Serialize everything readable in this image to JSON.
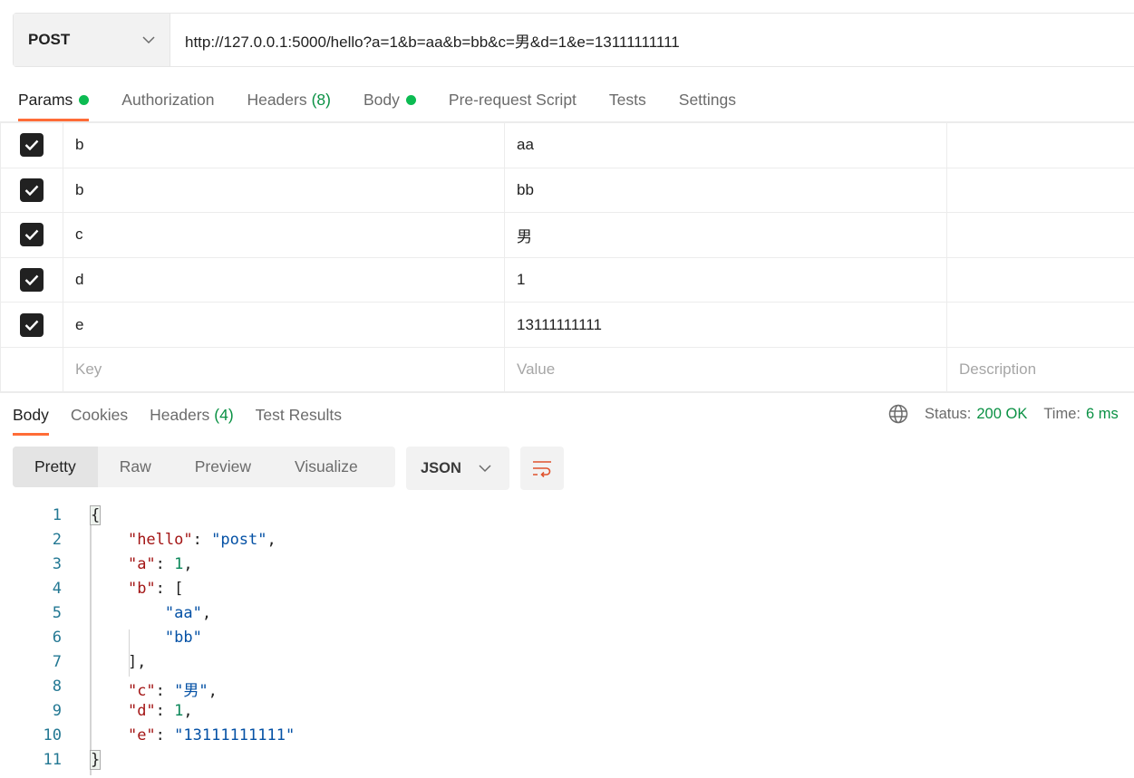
{
  "request": {
    "method": "POST",
    "url": "http://127.0.0.1:5000/hello?a=1&b=aa&b=bb&c=男&d=1&e=13111111111"
  },
  "request_tabs": [
    {
      "label": "Params",
      "dot": true
    },
    {
      "label": "Authorization"
    },
    {
      "label": "Headers",
      "count": "(8)"
    },
    {
      "label": "Body",
      "dot": true
    },
    {
      "label": "Pre-request Script"
    },
    {
      "label": "Tests"
    },
    {
      "label": "Settings"
    }
  ],
  "params": [
    {
      "key": "b",
      "value": "aa",
      "checked": true
    },
    {
      "key": "b",
      "value": "bb",
      "checked": true
    },
    {
      "key": "c",
      "value": "男",
      "checked": true
    },
    {
      "key": "d",
      "value": "1",
      "checked": true
    },
    {
      "key": "e",
      "value": "13111111111",
      "checked": true
    }
  ],
  "params_placeholder": {
    "key": "Key",
    "value": "Value",
    "description": "Description"
  },
  "response_tabs": [
    {
      "label": "Body"
    },
    {
      "label": "Cookies"
    },
    {
      "label": "Headers",
      "count": "(4)"
    },
    {
      "label": "Test Results"
    }
  ],
  "status": {
    "label": "Status:",
    "value": "200 OK",
    "time_label": "Time:",
    "time": "6 ms"
  },
  "view_modes": [
    "Pretty",
    "Raw",
    "Preview",
    "Visualize"
  ],
  "format": "JSON",
  "code_lines": [
    [
      {
        "t": "{",
        "c": ""
      }
    ],
    [
      {
        "t": "    ",
        "c": ""
      },
      {
        "t": "\"hello\"",
        "c": "k"
      },
      {
        "t": ": ",
        "c": ""
      },
      {
        "t": "\"post\"",
        "c": "s"
      },
      {
        "t": ",",
        "c": ""
      }
    ],
    [
      {
        "t": "    ",
        "c": ""
      },
      {
        "t": "\"a\"",
        "c": "k"
      },
      {
        "t": ": ",
        "c": ""
      },
      {
        "t": "1",
        "c": "n"
      },
      {
        "t": ",",
        "c": ""
      }
    ],
    [
      {
        "t": "    ",
        "c": ""
      },
      {
        "t": "\"b\"",
        "c": "k"
      },
      {
        "t": ": [",
        "c": ""
      }
    ],
    [
      {
        "t": "        ",
        "c": ""
      },
      {
        "t": "\"aa\"",
        "c": "s"
      },
      {
        "t": ",",
        "c": ""
      }
    ],
    [
      {
        "t": "        ",
        "c": ""
      },
      {
        "t": "\"bb\"",
        "c": "s"
      }
    ],
    [
      {
        "t": "    ],",
        "c": ""
      }
    ],
    [
      {
        "t": "    ",
        "c": ""
      },
      {
        "t": "\"c\"",
        "c": "k"
      },
      {
        "t": ": ",
        "c": ""
      },
      {
        "t": "\"男\"",
        "c": "s"
      },
      {
        "t": ",",
        "c": ""
      }
    ],
    [
      {
        "t": "    ",
        "c": ""
      },
      {
        "t": "\"d\"",
        "c": "k"
      },
      {
        "t": ": ",
        "c": ""
      },
      {
        "t": "1",
        "c": "n"
      },
      {
        "t": ",",
        "c": ""
      }
    ],
    [
      {
        "t": "    ",
        "c": ""
      },
      {
        "t": "\"e\"",
        "c": "k"
      },
      {
        "t": ": ",
        "c": ""
      },
      {
        "t": "\"13111111111\"",
        "c": "s"
      }
    ],
    [
      {
        "t": "}",
        "c": ""
      }
    ]
  ]
}
